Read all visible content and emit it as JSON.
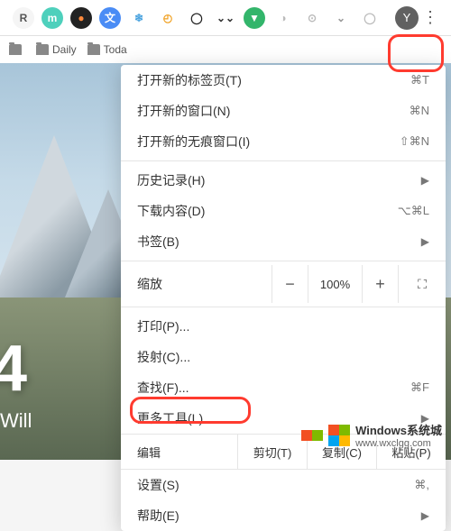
{
  "toolbar": {
    "ext_icons": [
      {
        "name": "readability-icon",
        "bg": "#f5f5f5",
        "fg": "#555",
        "txt": "R"
      },
      {
        "name": "mint-icon",
        "bg": "#4ed0bc",
        "fg": "#fff",
        "txt": "m"
      },
      {
        "name": "dark-icon",
        "bg": "#222",
        "fg": "#ff8a3c",
        "txt": "●"
      },
      {
        "name": "translate-icon",
        "bg": "#4a8cf5",
        "fg": "#fff",
        "txt": "文"
      },
      {
        "name": "snowflake-icon",
        "bg": "#fff",
        "fg": "#4aa3df",
        "txt": "❄"
      },
      {
        "name": "compass-icon",
        "bg": "#fff",
        "fg": "#f0a020",
        "txt": "◴"
      },
      {
        "name": "circle-icon",
        "bg": "#fff",
        "fg": "#222",
        "txt": "◯"
      },
      {
        "name": "chevrons-icon",
        "bg": "#fff",
        "fg": "#333",
        "txt": "⌄⌄"
      },
      {
        "name": "shield-icon",
        "bg": "#33b56b",
        "fg": "#fff",
        "txt": "▼"
      },
      {
        "name": "grey1-icon",
        "bg": "#fff",
        "fg": "#bbb",
        "txt": "◑"
      },
      {
        "name": "grey2-icon",
        "bg": "#fff",
        "fg": "#bbb",
        "txt": "⊙"
      },
      {
        "name": "pocket-icon",
        "bg": "#fff",
        "fg": "#999",
        "txt": "⌄"
      },
      {
        "name": "grey3-icon",
        "bg": "#fff",
        "fg": "#bbb",
        "txt": "◯"
      }
    ],
    "profile_letter": "Y",
    "menu_dots": "⋮"
  },
  "bookmarks": [
    {
      "label": ""
    },
    {
      "label": "Daily"
    },
    {
      "label": "Toda"
    }
  ],
  "hero": {
    "big": "4",
    "sub": "Will"
  },
  "menu": {
    "new_tab": "打开新的标签页(T)",
    "new_tab_sc": "⌘T",
    "new_window": "打开新的窗口(N)",
    "new_window_sc": "⌘N",
    "incognito": "打开新的无痕窗口(I)",
    "incognito_sc": "⇧⌘N",
    "history": "历史记录(H)",
    "downloads": "下载内容(D)",
    "downloads_sc": "⌥⌘L",
    "bookmarks": "书签(B)",
    "zoom": "缩放",
    "zoom_minus": "−",
    "zoom_val": "100%",
    "zoom_plus": "+",
    "zoom_fs": "⛶",
    "print": "打印(P)...",
    "cast": "投射(C)...",
    "find": "查找(F)...",
    "find_sc": "⌘F",
    "more_tools": "更多工具(L)",
    "edit": "编辑",
    "cut": "剪切(T)",
    "copy": "复制(C)",
    "paste": "粘贴(P)",
    "settings": "设置(S)",
    "settings_sc": "⌘,",
    "help": "帮助(E)"
  },
  "watermark": {
    "brand": "Windows系统城",
    "url": "www.wxclgg.com"
  }
}
